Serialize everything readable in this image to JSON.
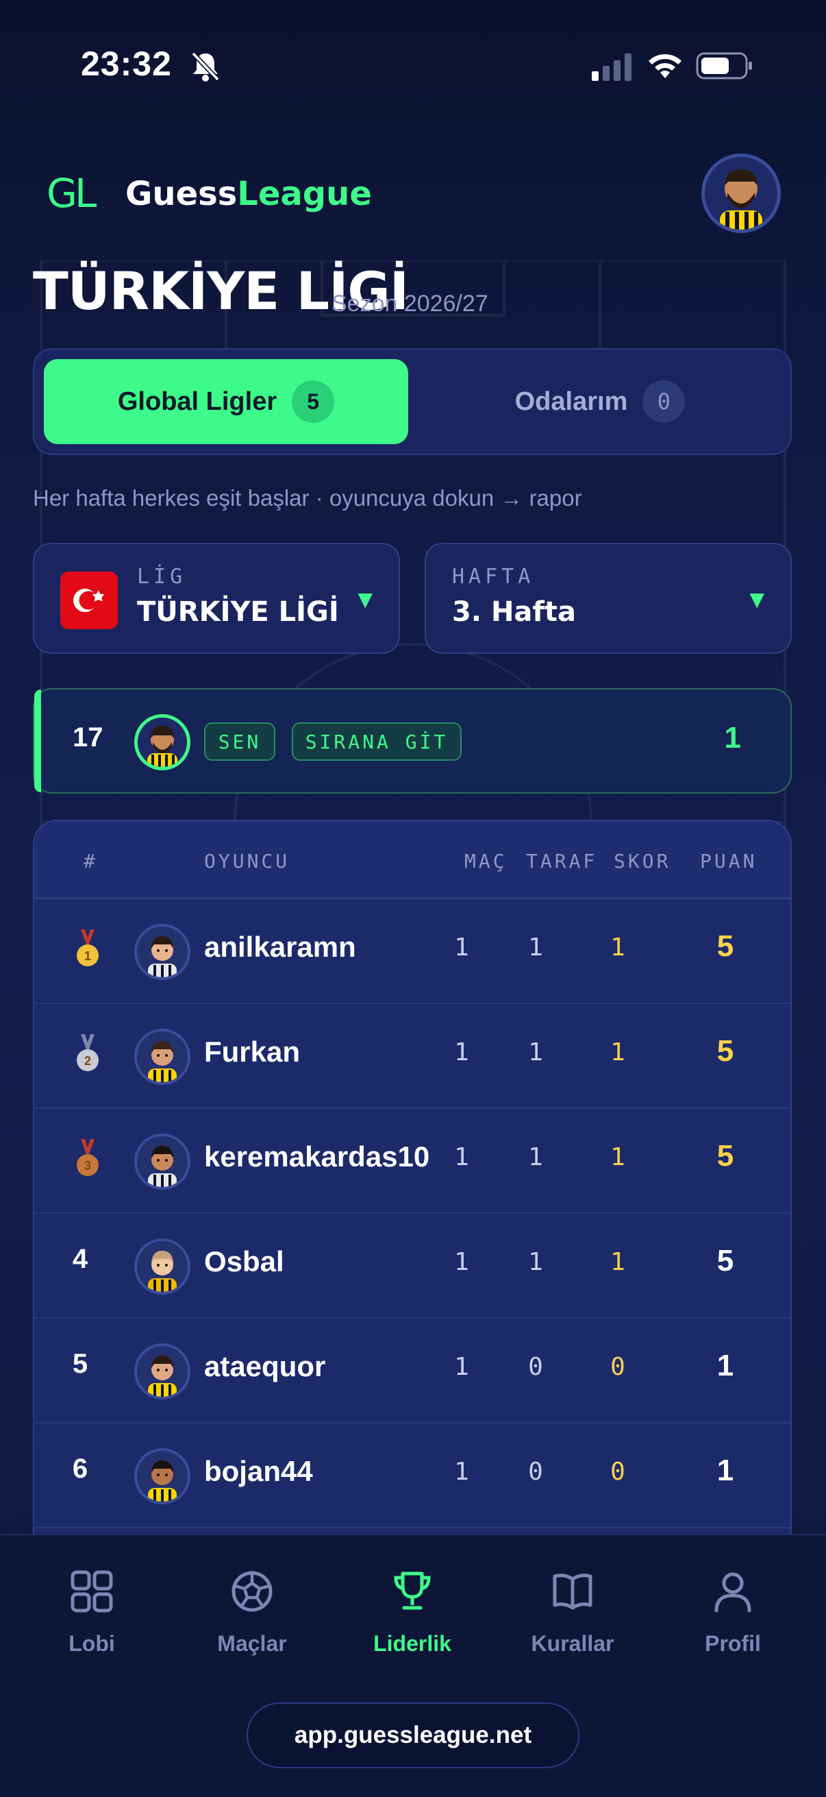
{
  "status_bar": {
    "time": "23:32"
  },
  "header": {
    "logo_mark": "GL",
    "brand_first": "Guess",
    "brand_second": "League"
  },
  "page": {
    "title": "TÜRKİYE LİGİ",
    "season": "Sezon 2026/27"
  },
  "tabs": [
    {
      "label": "Global Ligler",
      "count": "5",
      "active": true
    },
    {
      "label": "Odalarım",
      "count": "0",
      "active": false
    }
  ],
  "hint": "Her hafta herkes eşit başlar · oyuncuya dokun → rapor",
  "league_selector": {
    "label": "LİG",
    "value": "TÜRKİYE LİGİ"
  },
  "week_selector": {
    "label": "HAFTA",
    "value": "3. Hafta"
  },
  "me": {
    "rank": "17",
    "you_badge": "SEN",
    "goto_badge": "SIRANA GİT",
    "points": "1"
  },
  "table": {
    "headers": {
      "rank": "#",
      "player": "OYUNCU",
      "played": "MAÇ",
      "side": "TARAF",
      "score": "SKOR",
      "points": "PUAN"
    },
    "rows": [
      {
        "rank": "1",
        "medal": "gold",
        "name": "anilkaramn",
        "played": "1",
        "side": "1",
        "score": "1",
        "points": "5"
      },
      {
        "rank": "2",
        "medal": "silver",
        "name": "Furkan",
        "played": "1",
        "side": "1",
        "score": "1",
        "points": "5"
      },
      {
        "rank": "3",
        "medal": "bronze",
        "name": "keremakardas10",
        "played": "1",
        "side": "1",
        "score": "1",
        "points": "5"
      },
      {
        "rank": "4",
        "medal": "",
        "name": "Osbal",
        "played": "1",
        "side": "1",
        "score": "1",
        "points": "5"
      },
      {
        "rank": "5",
        "medal": "",
        "name": "ataequor",
        "played": "1",
        "side": "0",
        "score": "0",
        "points": "1"
      },
      {
        "rank": "6",
        "medal": "",
        "name": "bojan44",
        "played": "1",
        "side": "0",
        "score": "0",
        "points": "1"
      }
    ]
  },
  "nav": [
    {
      "label": "Lobi",
      "icon": "grid-icon",
      "active": false
    },
    {
      "label": "Maçlar",
      "icon": "soccer-ball-icon",
      "active": false
    },
    {
      "label": "Liderlik",
      "icon": "trophy-icon",
      "active": true
    },
    {
      "label": "Kurallar",
      "icon": "book-icon",
      "active": false
    },
    {
      "label": "Profil",
      "icon": "user-icon",
      "active": false
    }
  ],
  "url": "app.guessleague.net",
  "colors": {
    "accent": "#3dfa8a",
    "gold": "#ffd24a",
    "background": "#0e1638"
  }
}
